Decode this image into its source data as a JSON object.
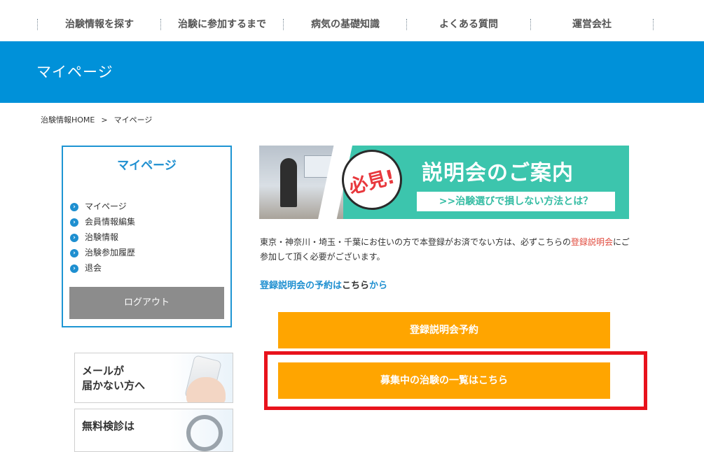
{
  "nav": {
    "items": [
      {
        "label": "治験情報を探す"
      },
      {
        "label": "治験に参加するまで"
      },
      {
        "label": "病気の基礎知識"
      },
      {
        "label": "よくある質問"
      },
      {
        "label": "運営会社"
      }
    ]
  },
  "header": {
    "title": "マイページ"
  },
  "breadcrumb": {
    "home": "治験情報HOME",
    "separator": ">",
    "current": "マイページ"
  },
  "sidebar": {
    "title": "マイページ",
    "items": [
      {
        "label": "マイページ"
      },
      {
        "label": "会員情報編集"
      },
      {
        "label": "治験情報"
      },
      {
        "label": "治験参加履歴"
      },
      {
        "label": "退会"
      }
    ],
    "bullet_glyph": "›",
    "logout_label": "ログアウト"
  },
  "side_banners": {
    "mail": {
      "line1": "メールが",
      "line2": "届かない方へ"
    },
    "checkup": {
      "line1": "無料検診は"
    }
  },
  "hero": {
    "badge": "必見!",
    "title": "説明会のご案内",
    "subtitle": ">>治験選びで損しない方法とは？"
  },
  "main": {
    "notice_text": "東京・神奈川・埼玉・千葉にお住いの方で本登録がお済でない方は、必ずこちらの",
    "notice_link": "登録説明会",
    "notice_suffix": "にご参加して頂く必要がございます。",
    "reserve_link": "登録説明会の予約は",
    "reserve_here": "こちら",
    "reserve_suffix": "から",
    "cta_reserve_label": "登録説明会予約",
    "cta_trials_label": "募集中の治験の一覧はこちら"
  },
  "colors": {
    "header_blue": "#0091d9",
    "accent_blue": "#1e8fd0",
    "cta_orange": "#ffa500",
    "link_red": "#e0483b",
    "logout_gray": "#8c8c8c",
    "highlight_red": "#e8121c",
    "hero_teal": "#3cc5ad"
  }
}
